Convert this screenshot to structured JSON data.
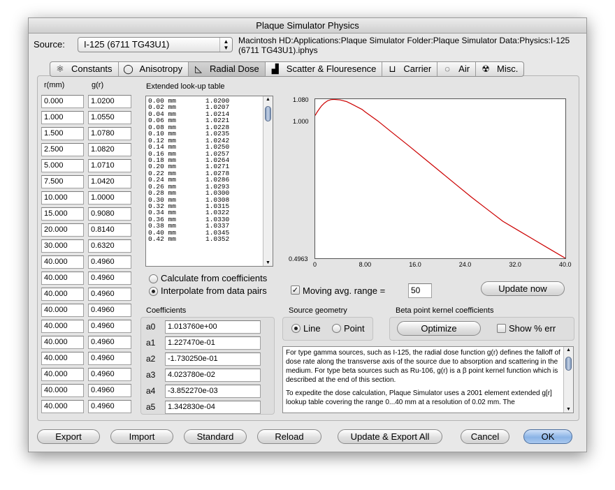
{
  "window": {
    "title": "Plaque Simulator Physics"
  },
  "source": {
    "label": "Source:",
    "selected": "I-125 (6711 TG43U1)",
    "path_line1": "Macintosh HD:Applications:Plaque Simulator Folder:Plaque Simulator Data:Physics:I-125",
    "path_line2": "(6711 TG43U1).iphys"
  },
  "tabs": [
    {
      "label": "Constants",
      "icon": "atom-icon",
      "glyph": "⚛"
    },
    {
      "label": "Anisotropy",
      "icon": "anisotropy-icon",
      "glyph": "◯"
    },
    {
      "label": "Radial Dose",
      "icon": "radial-dose-icon",
      "glyph": "◺"
    },
    {
      "label": "Scatter & Flouresence",
      "icon": "scatter-icon",
      "glyph": "▟"
    },
    {
      "label": "Carrier",
      "icon": "carrier-icon",
      "glyph": "⊔"
    },
    {
      "label": "Air",
      "icon": "air-icon",
      "glyph": "◌"
    },
    {
      "label": "Misc.",
      "icon": "radiation-icon",
      "glyph": "☢"
    }
  ],
  "data_pairs": {
    "col_r": "r(mm)",
    "col_g": "g(r)",
    "rows": [
      [
        "0.000",
        "1.0200"
      ],
      [
        "1.000",
        "1.0550"
      ],
      [
        "1.500",
        "1.0780"
      ],
      [
        "2.500",
        "1.0820"
      ],
      [
        "5.000",
        "1.0710"
      ],
      [
        "7.500",
        "1.0420"
      ],
      [
        "10.000",
        "1.0000"
      ],
      [
        "15.000",
        "0.9080"
      ],
      [
        "20.000",
        "0.8140"
      ],
      [
        "30.000",
        "0.6320"
      ],
      [
        "40.000",
        "0.4960"
      ],
      [
        "40.000",
        "0.4960"
      ],
      [
        "40.000",
        "0.4960"
      ],
      [
        "40.000",
        "0.4960"
      ],
      [
        "40.000",
        "0.4960"
      ],
      [
        "40.000",
        "0.4960"
      ],
      [
        "40.000",
        "0.4960"
      ],
      [
        "40.000",
        "0.4960"
      ],
      [
        "40.000",
        "0.4960"
      ],
      [
        "40.000",
        "0.4960"
      ]
    ]
  },
  "lookup": {
    "title": "Extended look-up table",
    "rows": [
      [
        "0.00 mm",
        "1.0200"
      ],
      [
        "0.02 mm",
        "1.0207"
      ],
      [
        "0.04 mm",
        "1.0214"
      ],
      [
        "0.06 mm",
        "1.0221"
      ],
      [
        "0.08 mm",
        "1.0228"
      ],
      [
        "0.10 mm",
        "1.0235"
      ],
      [
        "0.12 mm",
        "1.0242"
      ],
      [
        "0.14 mm",
        "1.0250"
      ],
      [
        "0.16 mm",
        "1.0257"
      ],
      [
        "0.18 mm",
        "1.0264"
      ],
      [
        "0.20 mm",
        "1.0271"
      ],
      [
        "0.22 mm",
        "1.0278"
      ],
      [
        "0.24 mm",
        "1.0286"
      ],
      [
        "0.26 mm",
        "1.0293"
      ],
      [
        "0.28 mm",
        "1.0300"
      ],
      [
        "0.30 mm",
        "1.0308"
      ],
      [
        "0.32 mm",
        "1.0315"
      ],
      [
        "0.34 mm",
        "1.0322"
      ],
      [
        "0.36 mm",
        "1.0330"
      ],
      [
        "0.38 mm",
        "1.0337"
      ],
      [
        "0.40 mm",
        "1.0345"
      ],
      [
        "0.42 mm",
        "1.0352"
      ]
    ]
  },
  "mode": {
    "calc_label": "Calculate from coefficients",
    "interp_label": "Interpolate from data pairs",
    "selected": "interpolate"
  },
  "moving_avg": {
    "label": "Moving avg. range =",
    "checked": true,
    "value": "50"
  },
  "update_now": "Update now",
  "chart_data": {
    "type": "line",
    "title": "",
    "xlabel": "",
    "ylabel": "",
    "xlim": [
      0,
      40.0
    ],
    "ylim": [
      0.4963,
      1.08
    ],
    "x_ticks": [
      "0",
      "8.00",
      "16.0",
      "24.0",
      "32.0",
      "40.0"
    ],
    "y_tick_top": "1.080",
    "y_tick_mid": "1.000",
    "y_tick_bottom": "0.4963",
    "x": [
      0,
      0.25,
      0.5,
      0.75,
      1,
      1.5,
      2,
      2.5,
      3,
      4,
      5,
      6,
      7.5,
      8,
      10,
      12,
      15,
      17.5,
      20,
      22.5,
      25,
      27.5,
      30,
      32.5,
      35,
      37.5,
      40
    ],
    "y": [
      1.02,
      1.03,
      1.039,
      1.047,
      1.055,
      1.066,
      1.074,
      1.078,
      1.079,
      1.077,
      1.071,
      1.06,
      1.042,
      1.033,
      1.0,
      0.963,
      0.908,
      0.861,
      0.814,
      0.767,
      0.72,
      0.676,
      0.632,
      0.598,
      0.564,
      0.53,
      0.4963
    ],
    "color": "#cc0000",
    "grid": false
  },
  "coefficients": {
    "title": "Coefficients",
    "items": [
      {
        "name": "a0",
        "value": "1.013760e+00"
      },
      {
        "name": "a1",
        "value": "1.227470e-01"
      },
      {
        "name": "a2",
        "value": "-1.730250e-01"
      },
      {
        "name": "a3",
        "value": "4.023780e-02"
      },
      {
        "name": "a4",
        "value": "-3.852270e-03"
      },
      {
        "name": "a5",
        "value": "1.342830e-04"
      }
    ]
  },
  "source_geometry": {
    "title": "Source geometry",
    "line_label": "Line",
    "point_label": "Point",
    "selected": "line"
  },
  "beta_kernel": {
    "title": "Beta point kernel coefficients",
    "optimize": "Optimize",
    "show_err_label": "Show % err",
    "show_err_checked": false
  },
  "info": {
    "p1": "For type gamma sources, such as I-125, the radial dose function g(r) defines the falloff of dose rate along the transverse axis of the source due to absorption and scattering in the medium. For type beta sources such as Ru-106, g(r) is a β point kernel function which is described at the end of this section.",
    "p2": "To expedite the dose calculation, Plaque Simulator uses a 2001 element extended g[r] lookup table covering the range 0...40 mm at a resolution of 0.02 mm. The"
  },
  "buttons": {
    "export": "Export",
    "import": "Import",
    "standard": "Standard",
    "reload": "Reload",
    "update_export_all": "Update & Export All",
    "cancel": "Cancel",
    "ok": "OK"
  },
  "colors": {
    "window_bg": "#e8e8e8",
    "plot_line": "#cc0000",
    "default_button": "#8bb4e6"
  }
}
